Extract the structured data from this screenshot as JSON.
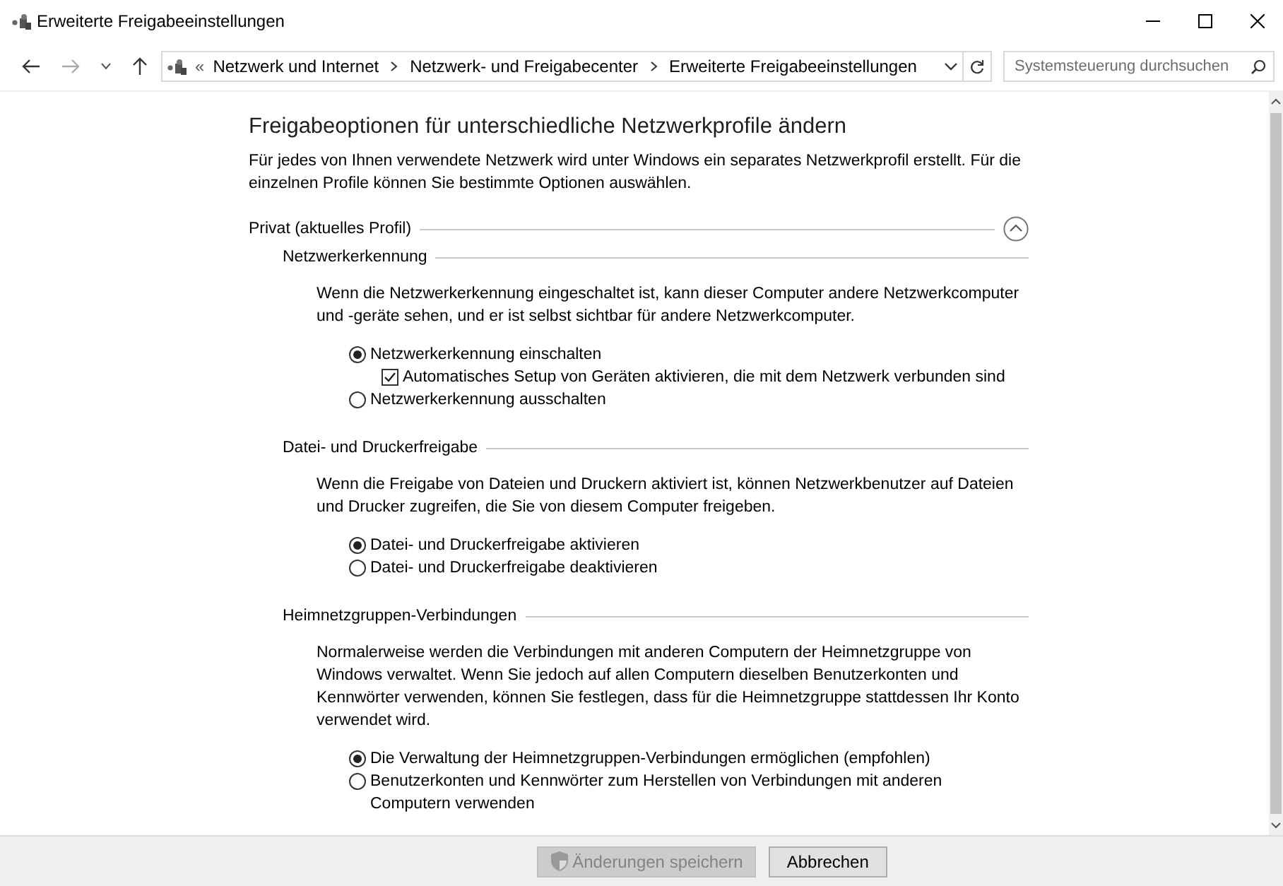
{
  "window": {
    "title": "Erweiterte Freigabeeinstellungen"
  },
  "address": {
    "overflow": "«",
    "crumbs": [
      "Netzwerk und Internet",
      "Netzwerk- und Freigabecenter",
      "Erweiterte Freigabeeinstellungen"
    ]
  },
  "search": {
    "placeholder": "Systemsteuerung durchsuchen"
  },
  "heading": "Freigabeoptionen für unterschiedliche Netzwerkprofile ändern",
  "intro": "Für jedes von Ihnen verwendete Netzwerk wird unter Windows ein separates Netzwerkprofil erstellt. Für die einzelnen Profile können Sie bestimmte Optionen auswählen.",
  "profiles": [
    {
      "title": "Privat (aktuelles Profil)",
      "expanded": true,
      "sections": [
        {
          "title": "Netzwerkerkennung",
          "description": "Wenn die Netzwerkerkennung eingeschaltet ist, kann dieser Computer andere Netzwerkcomputer und -geräte sehen, und er ist selbst sichtbar für andere Netzwerkcomputer.",
          "options": [
            {
              "kind": "radio",
              "label": "Netzwerkerkennung einschalten",
              "selected": true,
              "children": [
                {
                  "kind": "checkbox",
                  "label": "Automatisches Setup von Geräten aktivieren, die mit dem Netzwerk verbunden sind",
                  "checked": true
                }
              ]
            },
            {
              "kind": "radio",
              "label": "Netzwerkerkennung ausschalten",
              "selected": false
            }
          ]
        },
        {
          "title": "Datei- und Druckerfreigabe",
          "description": "Wenn die Freigabe von Dateien und Druckern aktiviert ist, können Netzwerkbenutzer auf Dateien und Drucker zugreifen, die Sie von diesem Computer freigeben.",
          "options": [
            {
              "kind": "radio",
              "label": "Datei- und Druckerfreigabe aktivieren",
              "selected": true
            },
            {
              "kind": "radio",
              "label": "Datei- und Druckerfreigabe deaktivieren",
              "selected": false
            }
          ]
        },
        {
          "title": "Heimnetzgruppen-Verbindungen",
          "description": "Normalerweise werden die Verbindungen mit anderen Computern der Heimnetzgruppe von Windows verwaltet. Wenn Sie jedoch auf allen Computern dieselben Benutzerkonten und Kennwörter verwenden, können Sie festlegen, dass für die Heimnetzgruppe stattdessen Ihr Konto verwendet wird.",
          "options": [
            {
              "kind": "radio",
              "label": "Die Verwaltung der Heimnetzgruppen-Verbindungen ermöglichen (empfohlen)",
              "selected": true
            },
            {
              "kind": "radio",
              "label": "Benutzerkonten und Kennwörter zum Herstellen von Verbindungen mit anderen Computern verwenden",
              "selected": false
            }
          ]
        }
      ]
    }
  ],
  "buttons": [
    {
      "label": "Änderungen speichern",
      "kind": "shield",
      "disabled": true
    },
    {
      "label": "Abbrechen",
      "kind": "plain",
      "disabled": false
    }
  ]
}
